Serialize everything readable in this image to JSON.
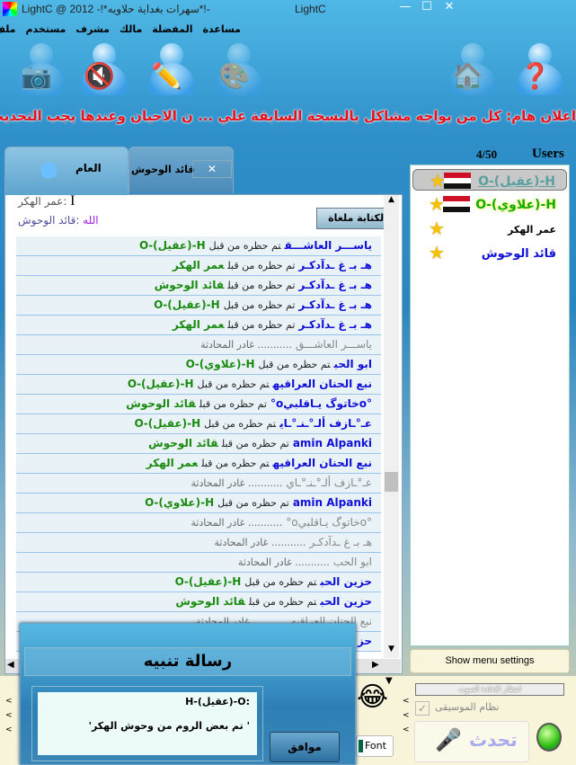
{
  "window": {
    "title": "LightC @ 2012  -!*سهرات بغداية حلاويه*!-",
    "app_name": "LightC"
  },
  "menu": [
    "ملف",
    "مستخدم",
    "مشرف",
    "مالك",
    "المفضلة",
    "مساعدة"
  ],
  "toolbar": [
    {
      "icon": "webcam-icon",
      "enabled": false
    },
    {
      "icon": "speaker-mute-icon",
      "enabled": true
    },
    {
      "icon": "edit-blocked-icon",
      "enabled": true
    },
    {
      "icon": "palette-icon",
      "enabled": false
    },
    {
      "icon": "home-icon",
      "enabled": false
    },
    {
      "icon": "help-icon",
      "enabled": true
    }
  ],
  "marquee": "اعلان هام: كل من يواجه مشاكل بالنسخة السابقة علي ... ن الاحيان وعندها يجب التحديث يدويا",
  "tabs": [
    {
      "label": "العام",
      "icon": "users-group-icon",
      "active": true
    },
    {
      "label": "قائد الوحوش",
      "closable": true
    }
  ],
  "chat_top": [
    {
      "name": "عمر الهكر",
      "text": "I"
    },
    {
      "name": "قائد الوحوش",
      "text": "الله"
    }
  ],
  "typing_disabled_button": "الكتابة ملغاة",
  "ban_text": "تم حظره من قبل",
  "left_text": "........... غادر المحادثة",
  "chat_rows": [
    {
      "name": "ياســـر العاشـــق",
      "by": "H-(عقيل)-O"
    },
    {
      "name": "هـ بـ غ ـدآدكـر",
      "by": "عمر الهكر"
    },
    {
      "name": "هـ بـ غ ـدآدكـر",
      "by": "قائد الوحوش"
    },
    {
      "name": "هـ بـ غ ـدآدكـر",
      "by": "H-(عقيل)-O"
    },
    {
      "name": "هـ بـ غ ـدآدكـر",
      "by": "عمر الهكر"
    },
    {
      "name": "ياســـر العاشـــق",
      "left": true
    },
    {
      "name": "ابو الحب",
      "by": "H-(علاوي)-O"
    },
    {
      "name": "نبع الحنان العراقيه",
      "by": "H-(عقيل)-O"
    },
    {
      "name": "°oخاتوگ يـاقلبيo°",
      "by": "قائد الوحوش"
    },
    {
      "name": "عـ°ـازف ألـ°ـنـ°ـاي",
      "by": "H-(عقيل)-O"
    },
    {
      "name": "amin Alpanki",
      "by": "قائد الوحوش"
    },
    {
      "name": "نبع الحنان العراقيه",
      "by": "عمر الهكر"
    },
    {
      "name": "عـ°ـازف ألـ°ـنـ°ـاي",
      "left": true
    },
    {
      "name": "amin Alpanki",
      "by": "H-(علاوي)-O"
    },
    {
      "name": "°oخاتوگ يـاقلبيo°",
      "left": true
    },
    {
      "name": "هـ بـ غ ـدآدكـر",
      "left": true
    },
    {
      "name": "ابو الحب",
      "left": true
    },
    {
      "name": "حزين الحب",
      "by": "H-(عقيل)-O"
    },
    {
      "name": "حزين الحب",
      "by": "قائد الوحوش"
    },
    {
      "name": "نبع الحنان العراقيه",
      "left": true
    },
    {
      "name": "حز",
      "by": ""
    }
  ],
  "users": {
    "label": "Users",
    "count": "4/50",
    "items": [
      {
        "name": "H-(عقيل)-O",
        "color": "#5aa0a0",
        "flag": true,
        "selected": true
      },
      {
        "name": "H-(علاوي)-O",
        "color": "#1a1",
        "flag": true,
        "highlight": "#ffff00"
      },
      {
        "name": "عمر الهكر",
        "color": "#000",
        "flag": false
      },
      {
        "name": "قائد الوحوش",
        "color": "#1010d8",
        "flag": false
      }
    ]
  },
  "show_menu_button": "Show menu settings",
  "progress_label": "انتظار الإعادة الصوت",
  "music_checkbox": {
    "label": "نظام الموسيقى",
    "checked": true
  },
  "talk_button": "تحدث",
  "font_button": "Font",
  "dialog": {
    "title": "رسالة تنبيه",
    "line1": "H-(عقيل)-O:",
    "line2": "' تم بعض الروم من وحوش الهكر'",
    "ok": "موافق"
  }
}
